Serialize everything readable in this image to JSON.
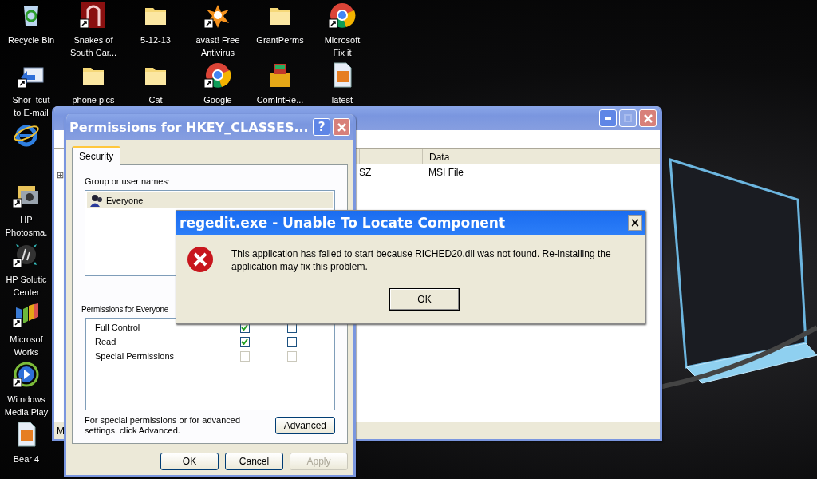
{
  "desktop_icons": [
    {
      "kind": "recycle",
      "lines": [
        "Recycle Bin"
      ],
      "shortcut": false
    },
    {
      "kind": "book",
      "lines": [
        "Snakes of",
        "South Car..."
      ],
      "shortcut": true
    },
    {
      "kind": "folder",
      "lines": [
        "5-12-13"
      ],
      "shortcut": false
    },
    {
      "kind": "avast",
      "lines": [
        "avast! Free",
        "Antivirus"
      ],
      "shortcut": true
    },
    {
      "kind": "folder",
      "lines": [
        "GrantPerms"
      ],
      "shortcut": false
    },
    {
      "kind": "chrome",
      "lines": [
        "Microsoft",
        "Fix it"
      ],
      "shortcut": true
    },
    {
      "kind": "email",
      "lines": [
        "Shor  tcut",
        "to E-mail"
      ],
      "shortcut": true
    },
    {
      "kind": "folder",
      "lines": [
        "phone pics"
      ],
      "shortcut": false
    },
    {
      "kind": "folder",
      "lines": [
        "Cat"
      ],
      "shortcut": false
    },
    {
      "kind": "chrome",
      "lines": [
        "Google"
      ],
      "shortcut": true
    },
    {
      "kind": "package",
      "lines": [
        "ComIntRe..."
      ],
      "shortcut": false
    },
    {
      "kind": "image",
      "lines": [
        "latest"
      ],
      "shortcut": false
    },
    {
      "kind": "ie",
      "shortcut": false
    },
    {
      "kind": "camera",
      "lines": [
        "HP",
        "Photosma."
      ],
      "shortcut": true
    },
    {
      "kind": "hp",
      "lines": [
        "HP Solutic",
        "Center"
      ],
      "shortcut": true
    },
    {
      "kind": "works",
      "lines": [
        "Microsof",
        "Works"
      ],
      "shortcut": true
    },
    {
      "kind": "media",
      "lines": [
        "Wi ndows",
        "Media Play"
      ],
      "shortcut": true
    },
    {
      "kind": "image",
      "lines": [
        "Bear 4"
      ],
      "shortcut": false
    }
  ],
  "regedit_window": {
    "active": false,
    "tree_glyph": "⊞",
    "columns": [
      "",
      "Data"
    ],
    "rows": [
      [
        "SZ",
        "MSI File"
      ]
    ],
    "status_bar": "M"
  },
  "permissions_dialog": {
    "active": false,
    "title": "Permissions for HKEY_CLASSES...",
    "help_button": "?",
    "tabs": [
      {
        "label": "Security",
        "selected": true
      }
    ],
    "group_label": "Group or user names:",
    "users": [
      {
        "name": "Everyone",
        "selected": true
      }
    ],
    "permissions_label": "Permissions for Everyone",
    "permissions": [
      {
        "name": "Full Control",
        "allow": true,
        "deny": false,
        "disabled": false
      },
      {
        "name": "Read",
        "allow": true,
        "deny": false,
        "disabled": false
      },
      {
        "name": "Special Permissions",
        "allow": false,
        "deny": false,
        "disabled": true
      }
    ],
    "advanced_note": "For special permissions or for advanced settings, click Advanced.",
    "advanced_button": "Advanced",
    "buttons": [
      {
        "label": "OK",
        "disabled": false
      },
      {
        "label": "Cancel",
        "disabled": false
      },
      {
        "label": "Apply",
        "disabled": true
      }
    ]
  },
  "error_dialog": {
    "active": true,
    "title": "regedit.exe - Unable To Locate Component",
    "close_button": "×",
    "message": "This application has failed to start because RICHED20.dll was not found. Re-installing the application may fix this problem.",
    "button": "OK"
  }
}
